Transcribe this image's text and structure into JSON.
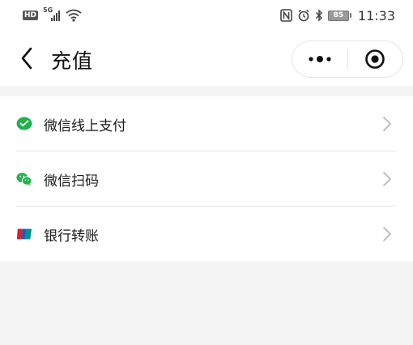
{
  "status_bar": {
    "hd": "HD",
    "network": "5G",
    "battery": "85",
    "time": "11:33"
  },
  "header": {
    "title": "充值",
    "back_icon": "chevron-left-icon",
    "more_icon": "more-dots-icon",
    "close_icon": "target-circle-icon"
  },
  "payment_methods": [
    {
      "label": "微信线上支付",
      "icon": "wechat-pay-icon",
      "color": "#22b24c"
    },
    {
      "label": "微信扫码",
      "icon": "wechat-icon",
      "color": "#22b24c"
    },
    {
      "label": "银行转账",
      "icon": "unionpay-icon",
      "color": "#1d5fa8"
    }
  ],
  "colors": {
    "background": "#f4f4f4",
    "surface": "#ffffff",
    "wechat_green": "#22b24c",
    "chevron": "#b8b8b8"
  }
}
